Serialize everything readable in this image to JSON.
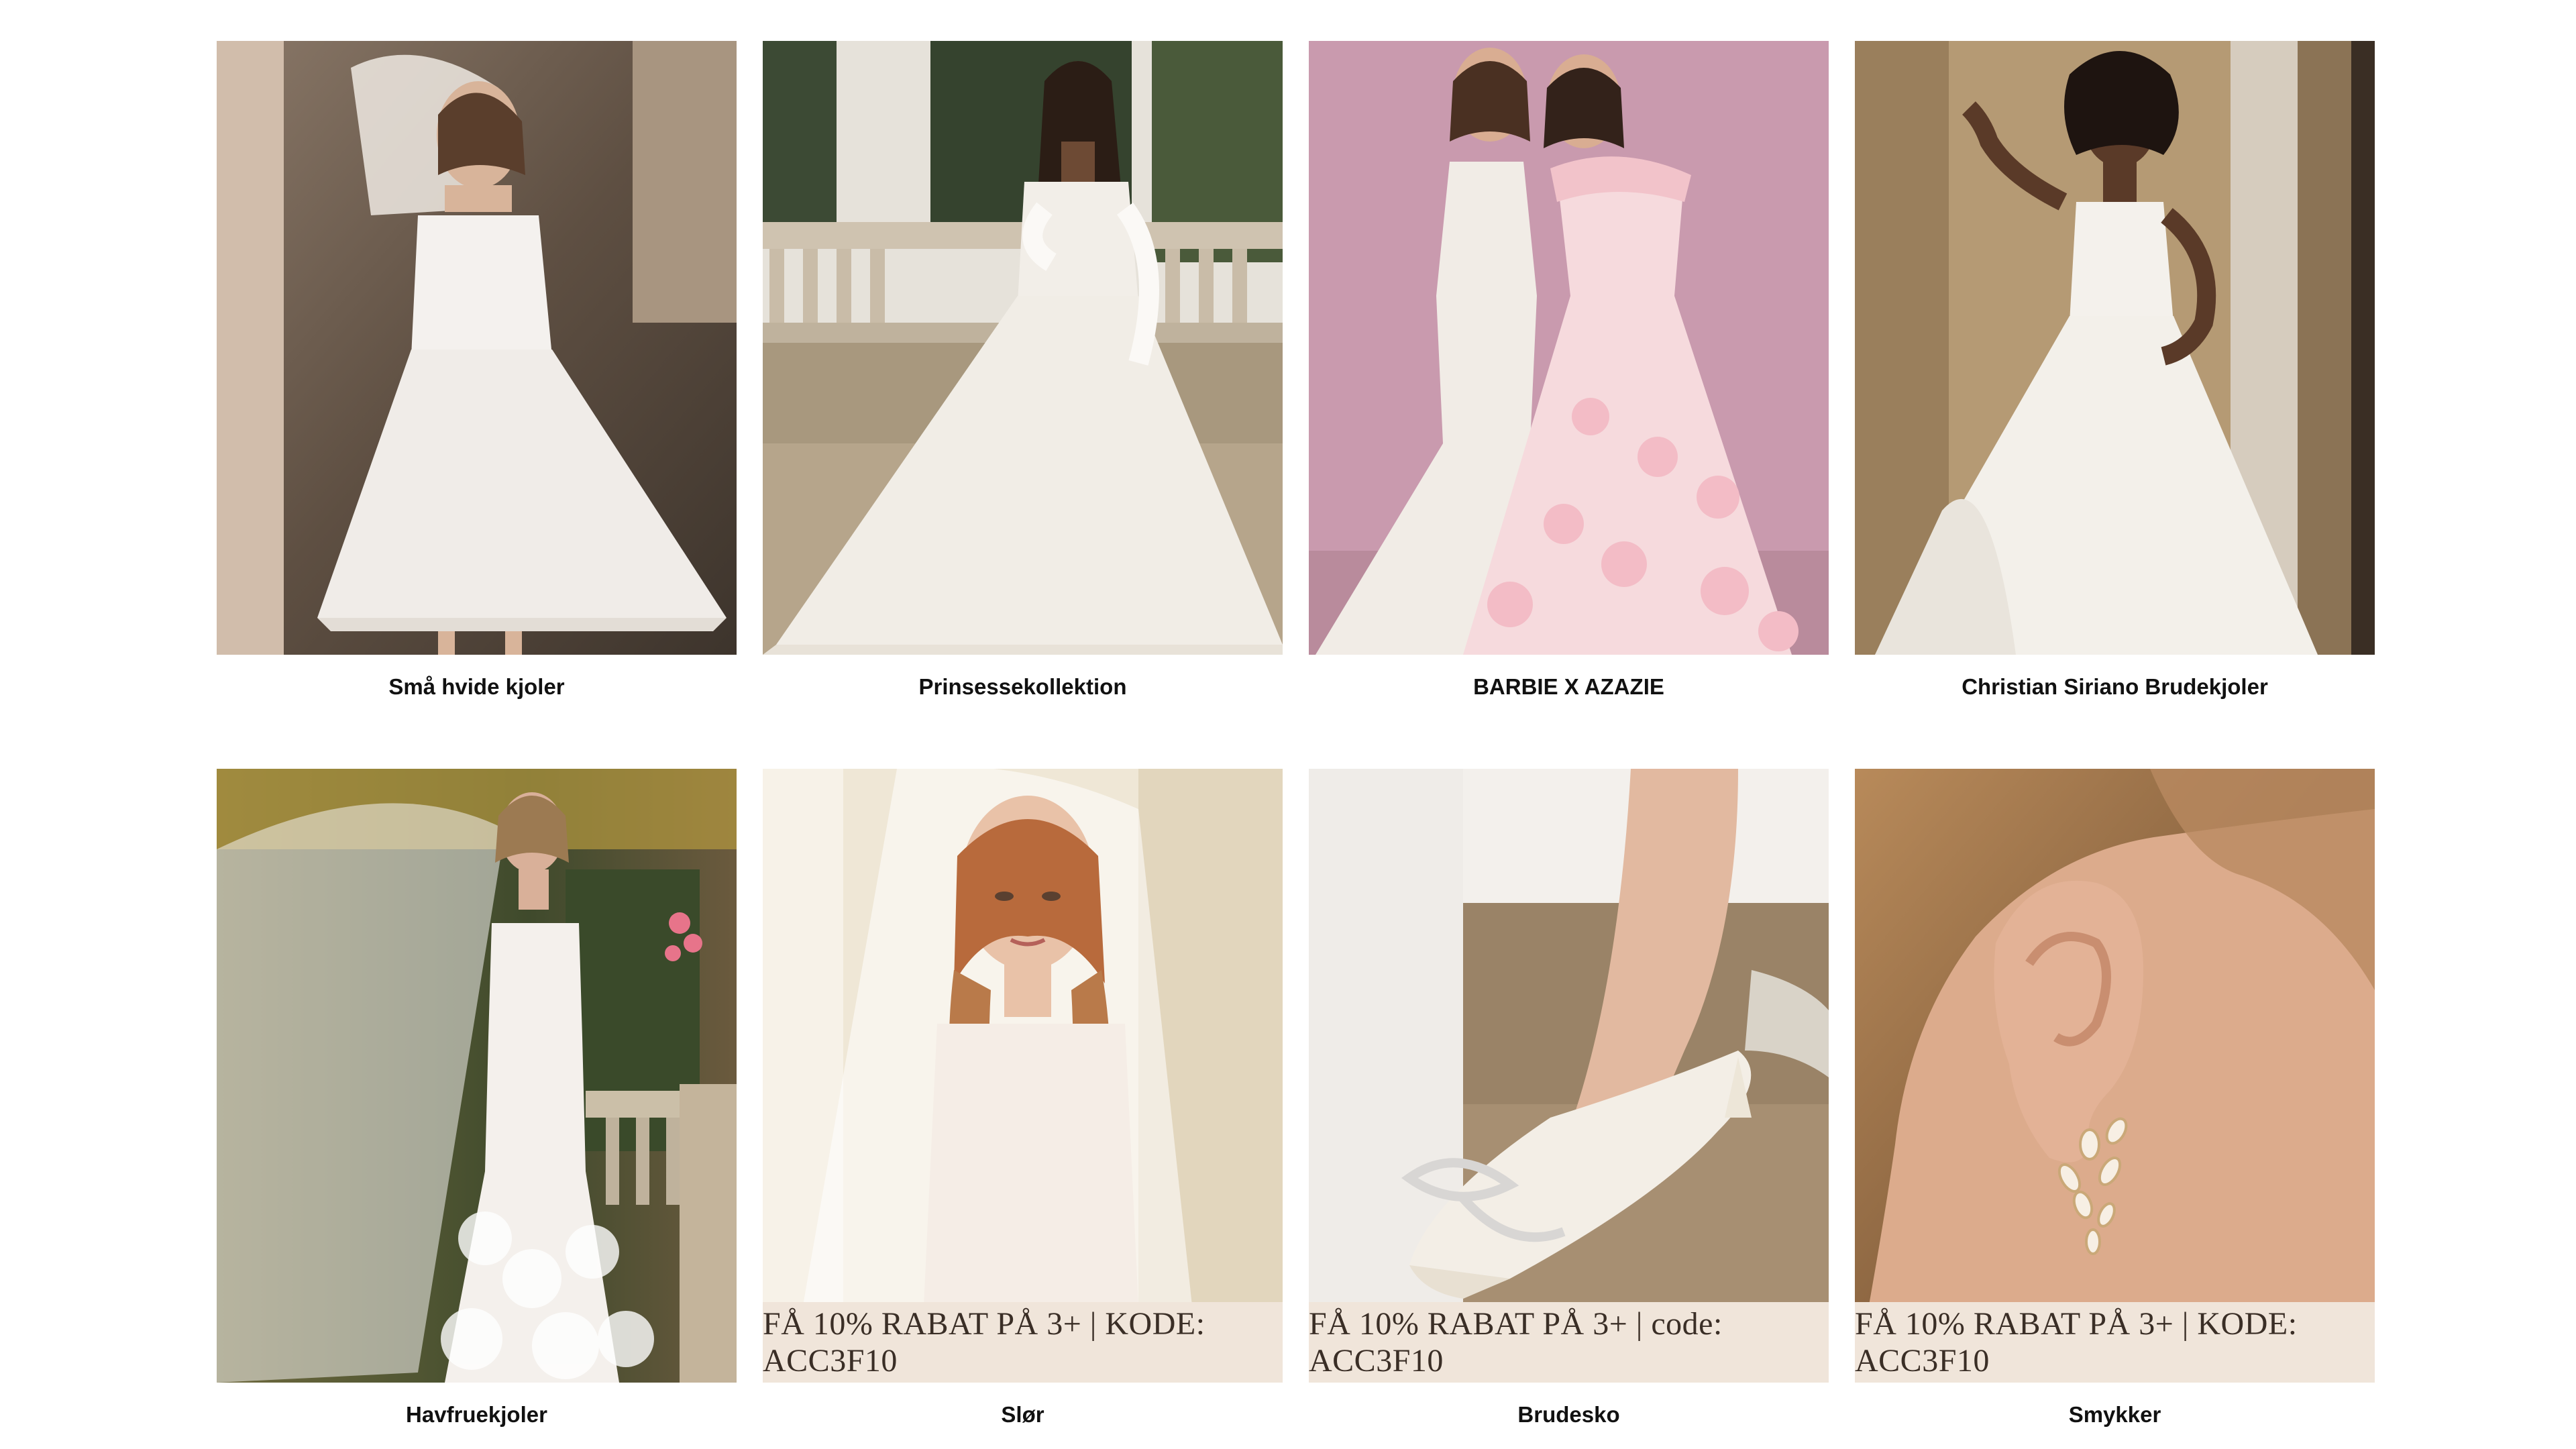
{
  "categories": [
    {
      "label": "Små hvide kjoler",
      "photo": "short-white-dress-photo",
      "promo": ""
    },
    {
      "label": "Prinsessekollektion",
      "photo": "princess-gown-photo",
      "promo": ""
    },
    {
      "label": "BARBIE X AZAZIE",
      "photo": "barbie-gowns-photo",
      "promo": ""
    },
    {
      "label": "Christian Siriano Brudekjoler",
      "photo": "ballgown-photo",
      "promo": ""
    },
    {
      "label": "Havfruekjoler",
      "photo": "mermaid-dress-photo",
      "promo": ""
    },
    {
      "label": "Slør",
      "photo": "veil-photo",
      "promo": "FÅ 10% RABAT PÅ 3+ | KODE: ACC3F10"
    },
    {
      "label": "Brudesko",
      "photo": "bridal-shoe-photo",
      "promo": "FÅ 10% RABAT PÅ 3+ | code: ACC3F10"
    },
    {
      "label": "Smykker",
      "photo": "earring-photo",
      "promo": "FÅ 10% RABAT PÅ 3+ | KODE: ACC3F10"
    }
  ]
}
